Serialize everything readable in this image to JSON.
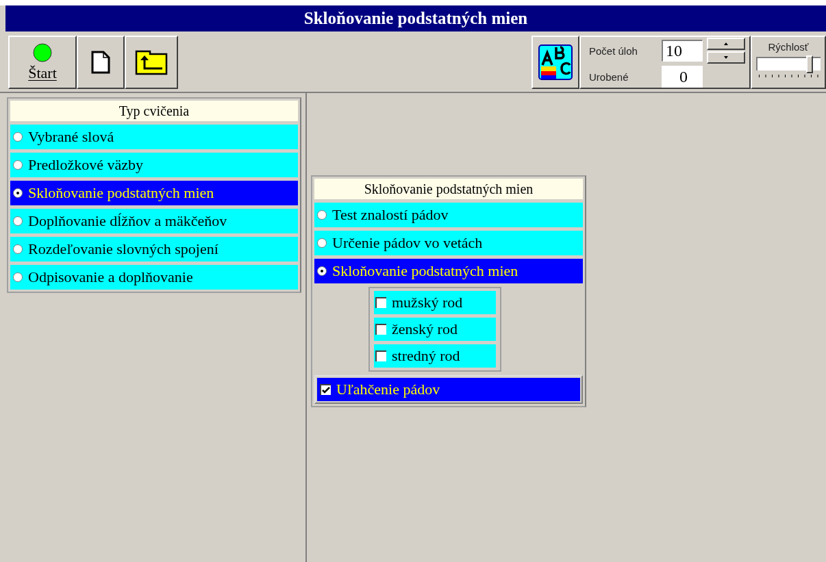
{
  "window": {
    "title": "Skloňovanie podstatných mien"
  },
  "toolbar": {
    "start_label": "Štart",
    "count_label": "Počet úloh",
    "count_value": "10",
    "done_label": "Urobené",
    "done_value": "0",
    "speed_label": "Rýchlosť",
    "speed": {
      "level": 0.85
    }
  },
  "exercise_types": {
    "title": "Typ cvičenia",
    "items": [
      {
        "label": "Vybrané slová",
        "selected": false
      },
      {
        "label": "Predložkové väzby",
        "selected": false
      },
      {
        "label": "Skloňovanie podstatných mien",
        "selected": true
      },
      {
        "label": "Doplňovanie dĺžňov a mäkčeňov",
        "selected": false
      },
      {
        "label": "Rozdeľovanie slovných spojení",
        "selected": false
      },
      {
        "label": "Odpisovanie a doplňovanie",
        "selected": false
      }
    ]
  },
  "subpanel": {
    "title": "Skloňovanie podstatných mien",
    "items": [
      {
        "label": "Test znalostí pádov",
        "selected": false
      },
      {
        "label": "Určenie pádov vo vetách",
        "selected": false
      },
      {
        "label": "Skloňovanie podstatných mien",
        "selected": true
      }
    ],
    "genders": [
      {
        "label": "mužský rod",
        "checked": false
      },
      {
        "label": "ženský rod",
        "checked": false
      },
      {
        "label": "stredný rod",
        "checked": false
      }
    ],
    "hint": {
      "label": "Uľahčenie pádov",
      "checked": true
    }
  }
}
